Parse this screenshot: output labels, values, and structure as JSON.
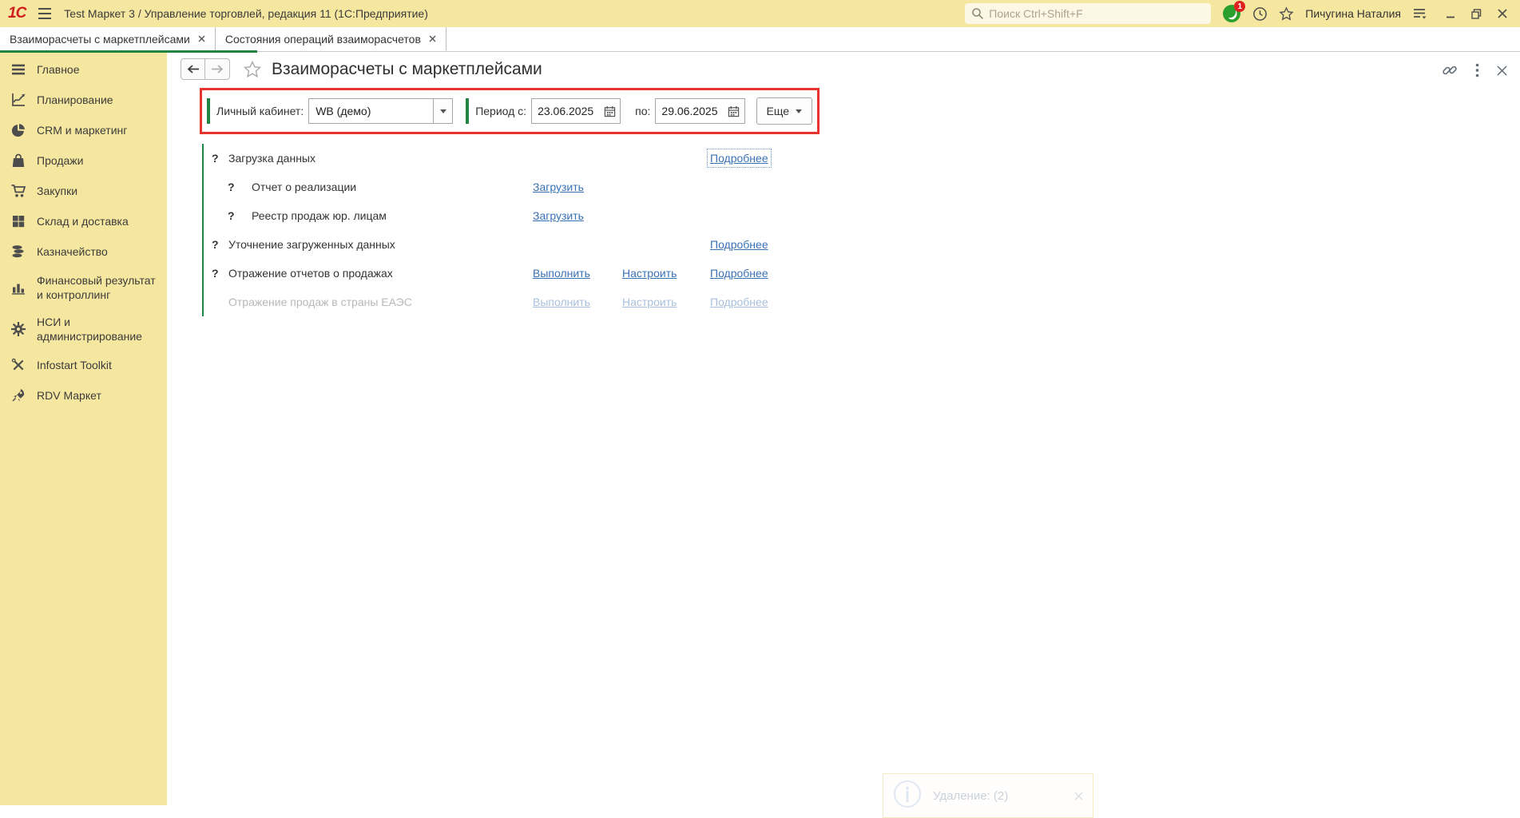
{
  "titlebar": {
    "logo_text": "1С",
    "title": "Test Маркет 3 / Управление торговлей, редакция 11  (1С:Предприятие)",
    "search_placeholder": "Поиск Ctrl+Shift+F",
    "notification_badge": "1",
    "user_name": "Пичугина Наталия"
  },
  "tabs": [
    {
      "label": "Взаиморасчеты с маркетплейсами",
      "active": true
    },
    {
      "label": "Состояния операций взаиморасчетов",
      "active": false
    }
  ],
  "sidebar": {
    "items": [
      {
        "key": "main",
        "label": "Главное",
        "icon": "menu-lines-icon"
      },
      {
        "key": "planning",
        "label": "Планирование",
        "icon": "planning-icon"
      },
      {
        "key": "crm",
        "label": "CRM и маркетинг",
        "icon": "pie-chart-icon"
      },
      {
        "key": "sales",
        "label": "Продажи",
        "icon": "shopping-bag-icon"
      },
      {
        "key": "purchases",
        "label": "Закупки",
        "icon": "shopping-cart-icon"
      },
      {
        "key": "warehouse",
        "label": "Склад и доставка",
        "icon": "warehouse-grid-icon"
      },
      {
        "key": "treasury",
        "label": "Казначейство",
        "icon": "coins-icon"
      },
      {
        "key": "finresult",
        "label": "Финансовый результат и контроллинг",
        "icon": "bar-chart-icon"
      },
      {
        "key": "nsi",
        "label": "НСИ и администрирование",
        "icon": "gear-icon"
      },
      {
        "key": "infostart",
        "label": "Infostart Toolkit",
        "icon": "tools-icon"
      },
      {
        "key": "rdv",
        "label": "RDV Маркет",
        "icon": "rocket-icon"
      }
    ]
  },
  "page": {
    "title": "Взаиморасчеты с маркетплейсами",
    "question_mark": "?",
    "filters": {
      "cabinet_label": "Личный кабинет:",
      "cabinet_value": "WB (демо)",
      "period_label": "Период с:",
      "period_from": "23.06.2025",
      "period_to_label": "по:",
      "period_to": "29.06.2025",
      "more_button": "Еще"
    },
    "operations": [
      {
        "label": "Загрузка данных",
        "indent": 0,
        "question": true,
        "disabled": false,
        "links": [
          {
            "text": "Подробнее",
            "col": "details",
            "focused": true
          }
        ]
      },
      {
        "label": "Отчет о реализации",
        "indent": 1,
        "question": true,
        "disabled": false,
        "links": [
          {
            "text": "Загрузить",
            "col": "action"
          }
        ]
      },
      {
        "label": "Реестр продаж юр. лицам",
        "indent": 1,
        "question": true,
        "disabled": false,
        "links": [
          {
            "text": "Загрузить",
            "col": "action"
          }
        ]
      },
      {
        "label": "Уточнение загруженных данных",
        "indent": 0,
        "question": true,
        "disabled": false,
        "links": [
          {
            "text": "Подробнее",
            "col": "details"
          }
        ]
      },
      {
        "label": "Отражение отчетов о продажах",
        "indent": 0,
        "question": true,
        "disabled": false,
        "links": [
          {
            "text": "Выполнить",
            "col": "action"
          },
          {
            "text": "Настроить",
            "col": "configure"
          },
          {
            "text": "Подробнее",
            "col": "details"
          }
        ]
      },
      {
        "label": "Отражение продаж в страны ЕАЭС",
        "indent": 0,
        "question": false,
        "disabled": true,
        "links": [
          {
            "text": "Выполнить",
            "col": "action"
          },
          {
            "text": "Настроить",
            "col": "configure"
          },
          {
            "text": "Подробнее",
            "col": "details"
          }
        ]
      }
    ]
  },
  "toast": {
    "text": "Удаление: (2)"
  },
  "colors": {
    "accent_yellow": "#f6e7a0",
    "accent_green": "#1f8540",
    "highlight_red": "#e7342c",
    "link_blue": "#3a72b8",
    "disabled_link": "#a8c0dd",
    "badge_red": "#e01f1f"
  }
}
